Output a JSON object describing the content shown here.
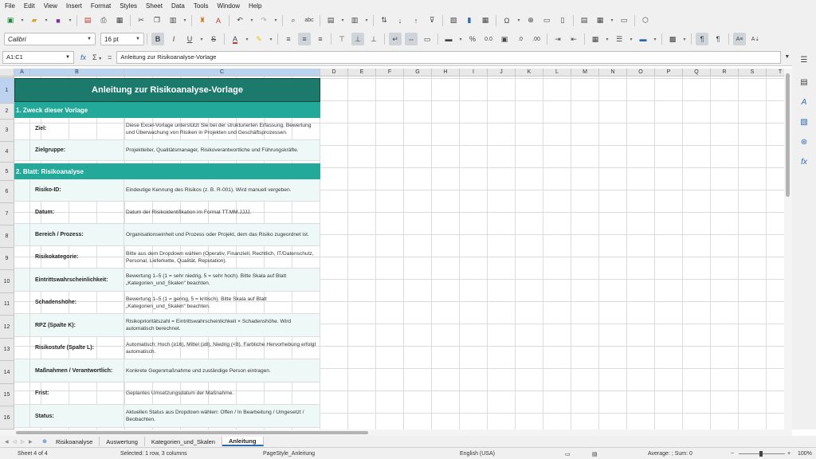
{
  "menu": [
    "File",
    "Edit",
    "View",
    "Insert",
    "Format",
    "Styles",
    "Sheet",
    "Data",
    "Tools",
    "Window",
    "Help"
  ],
  "format_toolbar": {
    "font_name": "Calibri",
    "font_size": "16 pt"
  },
  "formula_bar": {
    "cell_ref": "A1:C1",
    "content": "Anleitung zur Risikoanalyse-Vorlage"
  },
  "columns": [
    "A",
    "B",
    "C",
    "D",
    "E",
    "F",
    "G",
    "H",
    "I",
    "J",
    "K",
    "L",
    "M",
    "N",
    "O",
    "P",
    "Q",
    "R",
    "S",
    "T"
  ],
  "rows": [
    "1",
    "2",
    "3",
    "4",
    "5",
    "6",
    "7",
    "8",
    "9",
    "10",
    "11",
    "12",
    "13",
    "14",
    "15",
    "16"
  ],
  "sheet": {
    "title": "Anleitung zur Risikoanalyse-Vorlage",
    "section1": "1. Zweck dieser Vorlage",
    "row3": {
      "label": "Ziel:",
      "text": "Diese Excel-Vorlage unterstützt Sie bei der strukturierten Erfassung, Bewertung und Überwachung von Risiken in Projekten und Geschäftsprozessen."
    },
    "row4": {
      "label": "Zielgruppe:",
      "text": "Projektleiter, Qualitätsmanager, Risikoverantwortliche und Führungskräfte."
    },
    "section2": "2. Blatt: Risikoanalyse",
    "row6": {
      "label": "Risiko-ID:",
      "text": "Eindeutige Kennung des Risikos (z. B. R-001). Wird manuell vergeben."
    },
    "row7": {
      "label": "Datum:",
      "text": "Datum der Risikoidentifikation im Format TT.MM.JJJJ."
    },
    "row8": {
      "label": "Bereich / Prozess:",
      "text": "Organisationseinheit und Prozess oder Projekt, dem das Risiko zugeordnet ist."
    },
    "row9": {
      "label": "Risikokategorie:",
      "text": "Bitte aus dem Dropdown wählen (Operativ, Finanziell, Rechtlich, IT/Datenschutz, Personal, Lieferkette, Qualität, Reputation)."
    },
    "row10": {
      "label": "Eintrittswahrscheinlichkeit:",
      "text": "Bewertung 1–5 (1 = sehr niedrig, 5 = sehr hoch). Bitte Skala auf Blatt „Kategorien_und_Skalen“ beachten."
    },
    "row11": {
      "label": "Schadenshöhe:",
      "text": "Bewertung 1–5 (1 = gering, 5 = kritisch). Bitte Skala auf Blatt „Kategorien_und_Skalen“ beachten."
    },
    "row12": {
      "label": "RPZ (Spalte K):",
      "text": "Risikoprioritätszahl = Eintrittswahrscheinlichkeit × Schadenshöhe. Wird automatisch berechnet."
    },
    "row13": {
      "label": "Risikostufe (Spalte L):",
      "text": "Automatisch: Hoch (≥16), Mittel (≥8), Niedrig (<8). Farbliche Hervorhebung erfolgt automatisch."
    },
    "row14": {
      "label": "Maßnahmen / Verantwortlich:",
      "text": "Konkrete Gegenmaßnahme und zuständige Person eintragen."
    },
    "row15": {
      "label": "Frist:",
      "text": "Geplantes Umsetzungsdatum der Maßnahme."
    },
    "row16": {
      "label": "Status:",
      "text": "Aktuellen Status aus Dropdown wählen: Offen / In Bearbeitung / Umgesetzt / Beobachten."
    }
  },
  "tabs": [
    "Risikoanalyse",
    "Auswertung",
    "Kategorien_und_Skalen",
    "Anleitung"
  ],
  "active_tab": "Anleitung",
  "status": {
    "sheet": "Sheet 4 of 4",
    "selection": "Selected: 1 row, 3 columns",
    "page_style": "PageStyle_Anleitung",
    "language": "English (USA)",
    "summary": "Average: ; Sum: 0",
    "zoom": "100%"
  },
  "colors": {
    "title_bg": "#1c7a6c",
    "section_bg": "#22a99a",
    "shade": "#eef8f7",
    "selection": "#bcd3ef"
  }
}
